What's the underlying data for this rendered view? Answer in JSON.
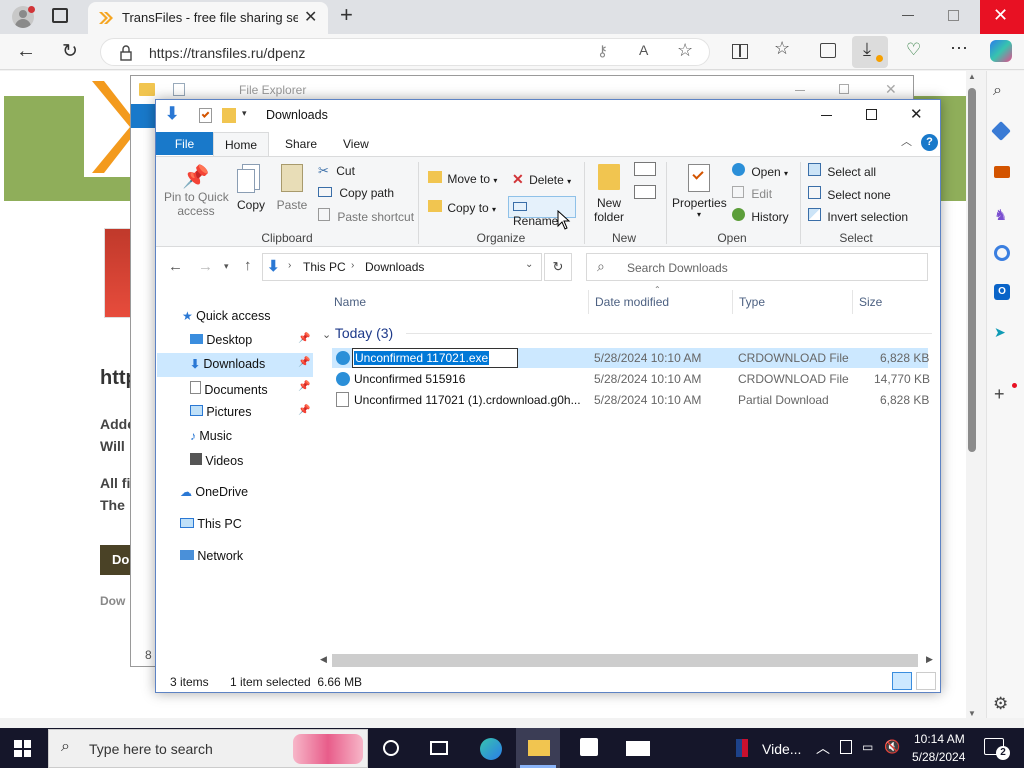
{
  "browser": {
    "tab_title": "TransFiles - free file sharing servi",
    "url": "https://transfiles.ru/dpenz",
    "new_tab_label": "+"
  },
  "webpage": {
    "heading_partial": "http",
    "line1": "Adde",
    "line2": "Will",
    "line3": "All fi",
    "line4": "The",
    "button_partial": "Do",
    "footer_partial": "Dow",
    "bottom_char": "8"
  },
  "bg_explorer": {
    "title": "File Explorer"
  },
  "explorer": {
    "title": "Downloads",
    "tabs": {
      "file": "File",
      "home": "Home",
      "share": "Share",
      "view": "View"
    },
    "clipboard": {
      "pin": [
        "Pin to Quick",
        "access"
      ],
      "copy": "Copy",
      "paste": "Paste",
      "cut": "Cut",
      "copy_path": "Copy path",
      "paste_shortcut": "Paste shortcut",
      "group": "Clipboard"
    },
    "organize": {
      "move_to": "Move to",
      "copy_to": "Copy to",
      "delete": "Delete",
      "rename": "Rename",
      "group": "Organize"
    },
    "new": {
      "new_folder": [
        "New",
        "folder"
      ],
      "group": "New"
    },
    "open": {
      "properties": "Properties",
      "open": "Open",
      "edit": "Edit",
      "history": "History",
      "group": "Open"
    },
    "select": {
      "select_all": "Select all",
      "select_none": "Select none",
      "invert": "Invert selection",
      "group": "Select"
    },
    "breadcrumb": {
      "this_pc": "This PC",
      "downloads": "Downloads"
    },
    "search_placeholder": "Search Downloads",
    "nav": {
      "quick_access": "Quick access",
      "desktop": "Desktop",
      "downloads": "Downloads",
      "documents": "Documents",
      "pictures": "Pictures",
      "music": "Music",
      "videos": "Videos",
      "onedrive": "OneDrive",
      "this_pc": "This PC",
      "network": "Network"
    },
    "columns": {
      "name": "Name",
      "date": "Date modified",
      "type": "Type",
      "size": "Size"
    },
    "group_header": "Today (3)",
    "files": [
      {
        "name": "Unconfirmed 117021.exe",
        "date": "5/28/2024 10:10 AM",
        "type": "CRDOWNLOAD File",
        "size": "6,828 KB"
      },
      {
        "name": "Unconfirmed 515916",
        "date": "5/28/2024 10:10 AM",
        "type": "CRDOWNLOAD File",
        "size": "14,770 KB"
      },
      {
        "name": "Unconfirmed 117021 (1).crdownload.g0h...",
        "date": "5/28/2024 10:10 AM",
        "type": "Partial Download",
        "size": "6,828 KB"
      }
    ],
    "status": {
      "items": "3 items",
      "selected": "1 item selected  6.66 MB"
    }
  },
  "taskbar": {
    "search_placeholder": "Type here to search",
    "video_label": "Vide...",
    "time": "10:14 AM",
    "date": "5/28/2024",
    "notification_count": "2"
  },
  "colors": {
    "accent": "#1979ca",
    "selection": "#cce8ff",
    "taskbar": "#15162a",
    "web_green": "#8fae5a"
  }
}
